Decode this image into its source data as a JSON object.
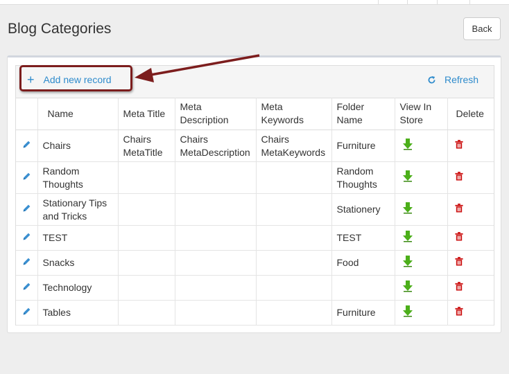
{
  "page": {
    "title": "Blog Categories",
    "back_label": "Back"
  },
  "toolbar": {
    "add_label": "Add new record",
    "add_icon": "plus-icon",
    "refresh_label": "Refresh",
    "refresh_icon": "refresh-icon"
  },
  "grid": {
    "columns": {
      "edit": "",
      "name": "Name",
      "meta_title": "Meta Title",
      "meta_description": "Meta Description",
      "meta_keywords": "Meta Keywords",
      "folder_name": "Folder Name",
      "view_in_store": "View In Store",
      "delete": "Delete"
    },
    "rows": [
      {
        "name": "Chairs",
        "meta_title": "Chairs MetaTitle",
        "meta_description": "Chairs MetaDescription",
        "meta_keywords": "Chairs MetaKeywords",
        "folder_name": "Furniture"
      },
      {
        "name": "Random Thoughts",
        "meta_title": "",
        "meta_description": "",
        "meta_keywords": "",
        "folder_name": "Random Thoughts"
      },
      {
        "name": "Stationary Tips and Tricks",
        "meta_title": "",
        "meta_description": "",
        "meta_keywords": "",
        "folder_name": "Stationery"
      },
      {
        "name": "TEST",
        "meta_title": "",
        "meta_description": "",
        "meta_keywords": "",
        "folder_name": "TEST"
      },
      {
        "name": "Snacks",
        "meta_title": "",
        "meta_description": "",
        "meta_keywords": "",
        "folder_name": "Food"
      },
      {
        "name": "Technology",
        "meta_title": "",
        "meta_description": "",
        "meta_keywords": "",
        "folder_name": ""
      },
      {
        "name": "Tables",
        "meta_title": "",
        "meta_description": "",
        "meta_keywords": "",
        "folder_name": "Furniture"
      }
    ],
    "row_icons": {
      "edit": "pencil-icon",
      "view": "green-down-arrow-icon",
      "delete": "trash-icon"
    }
  },
  "annotation": {
    "color": "#7c1d1d",
    "target": "add-new-record-button"
  },
  "colors": {
    "link": "#2e8bcc",
    "edit_icon": "#3a8fd0",
    "view_icon": "#4caf1a",
    "delete_icon": "#cc1111",
    "background": "#eeeeee"
  }
}
